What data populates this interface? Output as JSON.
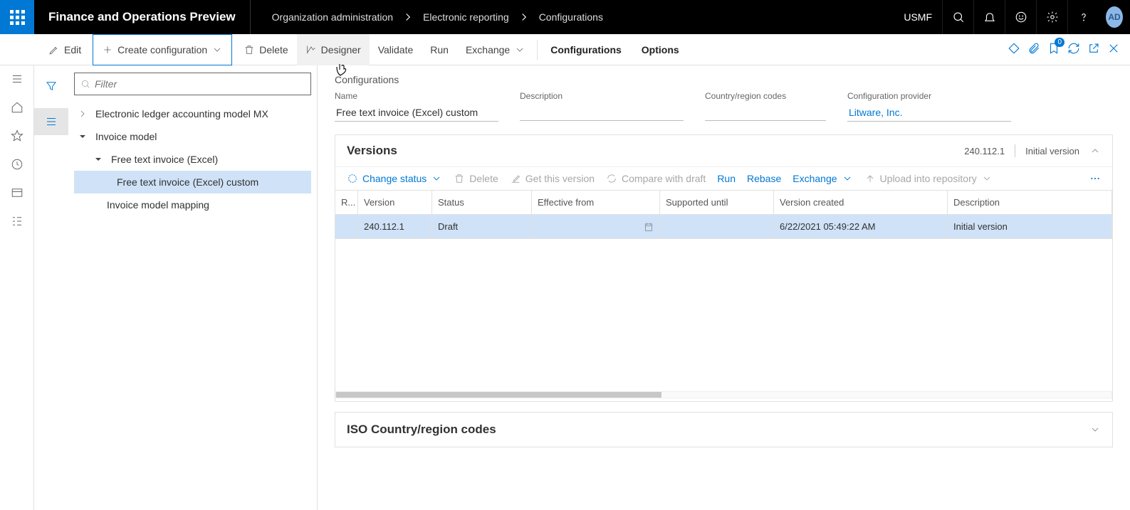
{
  "topbar": {
    "app_title": "Finance and Operations Preview",
    "breadcrumb": [
      "Organization administration",
      "Electronic reporting",
      "Configurations"
    ],
    "entity": "USMF",
    "avatar": "AD"
  },
  "actionbar": {
    "edit": "Edit",
    "create": "Create configuration",
    "delete": "Delete",
    "designer": "Designer",
    "validate": "Validate",
    "run": "Run",
    "exchange": "Exchange",
    "configurations": "Configurations",
    "options": "Options",
    "badge_count": "0"
  },
  "tree": {
    "filter_placeholder": "Filter",
    "nodes": {
      "ledger_mx": "Electronic ledger accounting model MX",
      "invoice_model": "Invoice model",
      "fti_excel": "Free text invoice (Excel)",
      "fti_custom": "Free text invoice (Excel) custom",
      "inv_mapping": "Invoice model mapping"
    }
  },
  "main": {
    "section": "Configurations",
    "fields": {
      "name_label": "Name",
      "name_value": "Free text invoice (Excel) custom",
      "desc_label": "Description",
      "desc_value": "",
      "crc_label": "Country/region codes",
      "crc_value": "",
      "provider_label": "Configuration provider",
      "provider_value": "Litware, Inc."
    },
    "versions": {
      "title": "Versions",
      "summary_version": "240.112.1",
      "summary_desc": "Initial version",
      "toolbar": {
        "change_status": "Change status",
        "delete": "Delete",
        "get_version": "Get this version",
        "compare": "Compare with draft",
        "run": "Run",
        "rebase": "Rebase",
        "exchange": "Exchange",
        "upload": "Upload into repository"
      },
      "columns": {
        "r": "R...",
        "version": "Version",
        "status": "Status",
        "eff": "Effective from",
        "sup": "Supported until",
        "created": "Version created",
        "desc": "Description"
      },
      "row": {
        "version": "240.112.1",
        "status": "Draft",
        "eff": "",
        "sup": "",
        "created": "6/22/2021 05:49:22 AM",
        "desc": "Initial version"
      }
    },
    "iso_panel": "ISO Country/region codes"
  }
}
